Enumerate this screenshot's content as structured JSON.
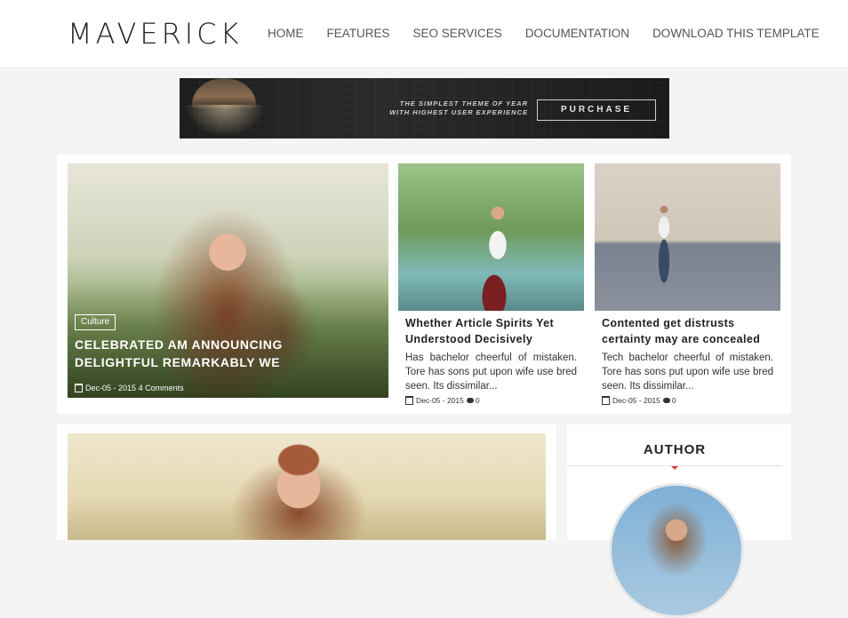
{
  "header": {
    "logo": "MAVERICK",
    "nav": [
      {
        "label": "HOME"
      },
      {
        "label": "FEATURES"
      },
      {
        "label": "SEO SERVICES"
      },
      {
        "label": "DOCUMENTATION"
      },
      {
        "label": "DOWNLOAD THIS TEMPLATE"
      }
    ]
  },
  "banner": {
    "tagline_1": "THE SIMPLEST THEME OF YEAR",
    "tagline_2": "WITH HIGHEST USER EXPERIENCE",
    "button": "PURCHASE"
  },
  "featured": {
    "main": {
      "category": "Culture",
      "title": "CELEBRATED AM ANNOUNCING DELIGHTFUL REMARKABLY WE",
      "date": "Dec-05 - 2015",
      "comments": "4 Comments"
    },
    "cards": [
      {
        "title": "Whether Article Spirits Yet Understood Decisively",
        "excerpt": "Has bachelor cheerful of mistaken. Tore has sons put upon wife use bred seen. Its dissimilar...",
        "date": "Dec-05 - 2015",
        "comments": "0"
      },
      {
        "title": "Contented get distrusts certainty may are concealed",
        "excerpt": "Tech bachelor cheerful of mistaken. Tore has sons put upon wife use bred seen. Its dissimilar...",
        "date": "Dec-05 - 2015",
        "comments": "0"
      }
    ]
  },
  "sidebar": {
    "widget_title": "AUTHOR"
  }
}
